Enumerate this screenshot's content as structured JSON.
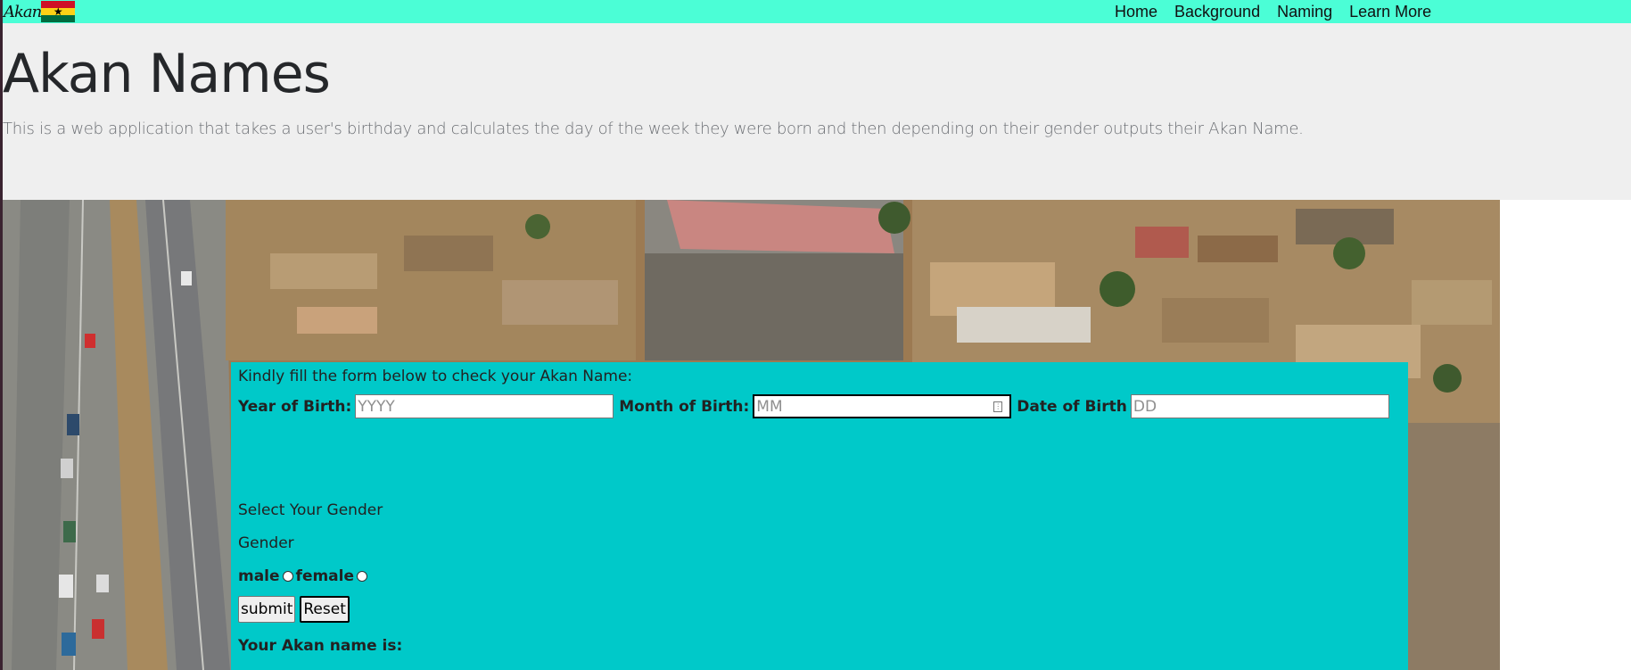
{
  "nav": {
    "brand": "Akan",
    "links": [
      "Home",
      "Background",
      "Naming",
      "Learn More"
    ]
  },
  "header": {
    "title": "Akan Names",
    "description": "This is a web application that takes a user's birthday and calculates the day of the week they were born and then depending on their gender outputs their Akan Name."
  },
  "form": {
    "intro": "Kindly fill the form below to check your Akan Name:",
    "year_label": "Year of Birth:",
    "year_placeholder": "YYYY",
    "month_label": "Month of Birth:",
    "month_placeholder": "MM",
    "date_label": "Date of Birth",
    "date_placeholder": "DD",
    "gender_prompt": "Select Your Gender",
    "gender_label": "Gender",
    "male_label": "male",
    "female_label": "female",
    "submit_label": "submit",
    "reset_label": "Reset",
    "result_label": "Your Akan name is:"
  },
  "colors": {
    "navbar": "#4bfed6",
    "jumbotron": "#efefef",
    "form_bg": "#00c9c9"
  }
}
